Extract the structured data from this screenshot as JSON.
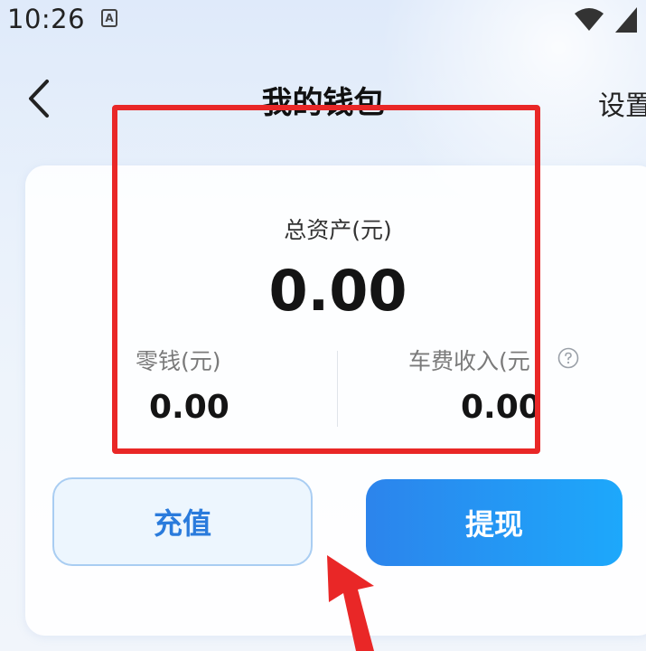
{
  "status_bar": {
    "time": "10:26",
    "notification_badge": "A"
  },
  "header": {
    "title": "我的钱包",
    "settings_label": "设置"
  },
  "wallet": {
    "total_label": "总资产(元)",
    "total_value": "0.00",
    "change_label": "零钱(元)",
    "change_value": "0.00",
    "fare_income_label": "车费收入(元",
    "fare_income_value": "0.00"
  },
  "actions": {
    "recharge_label": "充值",
    "withdraw_label": "提现"
  },
  "icons": {
    "back": "chevron-left-icon",
    "help": "question-circle-icon",
    "wifi": "wifi-icon",
    "signal": "signal-icon"
  },
  "colors": {
    "accent": "#2a7bdc",
    "withdraw_gradient_start": "#2c84ec",
    "withdraw_gradient_end": "#1da8fb",
    "annotation": "#e92727"
  }
}
